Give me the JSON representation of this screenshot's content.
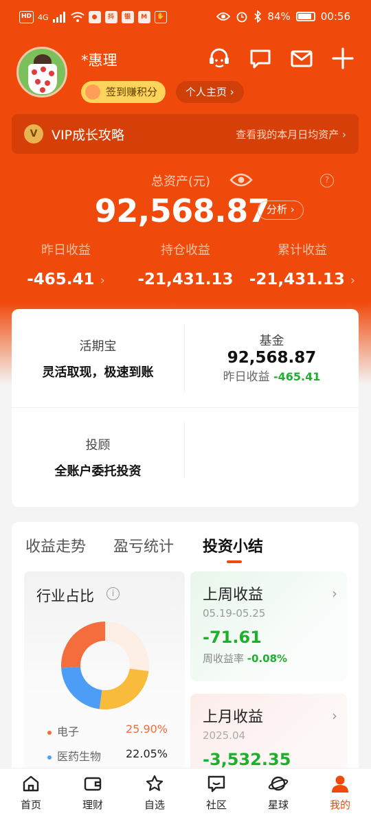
{
  "status_bar": {
    "battery": "84%",
    "time": "00:56",
    "network": "4G",
    "app_icons": [
      "HD",
      "抖",
      "银",
      "M"
    ]
  },
  "profile": {
    "username": "*惠理",
    "checkin_label": "签到赚积分",
    "homepage_label": "个人主页 ›"
  },
  "vip": {
    "title": "VIP成长攻略",
    "link": "查看我的本月日均资产 ›"
  },
  "assets": {
    "total_label": "总资产(元)",
    "total_value": "92,568.87",
    "analyze_label": "分析 ›",
    "help_icon": "?",
    "stats": [
      {
        "label": "昨日收益",
        "value": "-465.41"
      },
      {
        "label": "持仓收益",
        "value": "-21,431.13"
      },
      {
        "label": "累计收益",
        "value": "-21,431.13"
      }
    ]
  },
  "products": {
    "huoqibao": {
      "title": "活期宝",
      "subtitle": "灵活取现，极速到账"
    },
    "fund": {
      "title": "基金",
      "value": "92,568.87",
      "yesterday_label": "昨日收益",
      "yesterday_value": "-465.41"
    },
    "advisor": {
      "title": "投顾",
      "subtitle": "全账户委托投资"
    }
  },
  "analysis": {
    "tabs": [
      "收益走势",
      "盈亏统计",
      "投资小结"
    ],
    "active_tab": 2,
    "industry": {
      "title": "行业占比",
      "info_icon": "i",
      "legend": [
        {
          "name": "电子",
          "pct": "25.90%",
          "color": "#f36d3d",
          "pct_color": "#f36d3d"
        },
        {
          "name": "医药生物",
          "pct": "22.05%",
          "color": "#4d9cf5",
          "pct_color": "#222222"
        }
      ]
    },
    "last_week": {
      "title": "上周收益",
      "date": "05.19-05.25",
      "value": "-71.61",
      "rate_label": "周收益率",
      "rate_value": "-0.08%"
    },
    "last_month": {
      "title": "上月收益",
      "date": "2025.04",
      "value": "-3,532.35"
    }
  },
  "chart_data": {
    "type": "pie",
    "categories": [
      "电子",
      "医药生物"
    ],
    "values": [
      25.9,
      22.05
    ],
    "title": "行业占比",
    "colors": [
      "#f36d3d",
      "#4d9cf5"
    ],
    "remainder_slices": [
      {
        "value": 25.0,
        "color": "#f9bb3c"
      },
      {
        "value": 27.05,
        "color": "#fdeee6"
      }
    ]
  },
  "nav": {
    "items": [
      "首页",
      "理财",
      "自选",
      "社区",
      "星球",
      "我的"
    ],
    "active": 5
  },
  "colors": {
    "brand": "#ef4a0c",
    "positive_green": "#1cb02d",
    "bg": "#f4f4f4"
  }
}
